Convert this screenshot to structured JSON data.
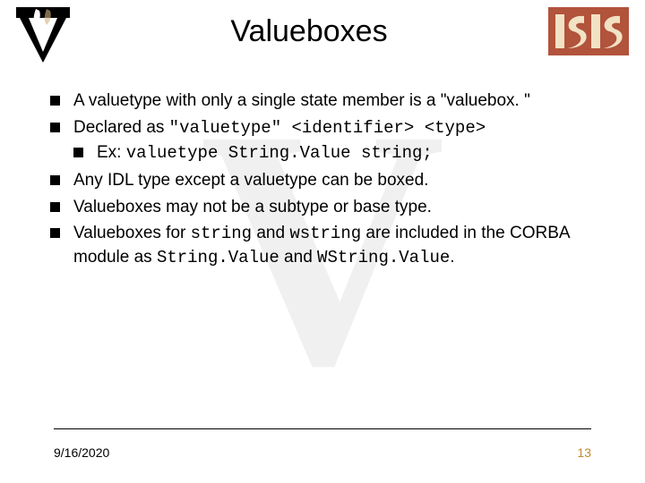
{
  "title": "Valueboxes",
  "bullets": {
    "b1": "A valuetype with only a single state member is a \"valuebox. \"",
    "b2_prefix": "Declared as ",
    "b2_code": "\"valuetype\" <identifier> <type>",
    "b2_sub_prefix": "Ex: ",
    "b2_sub_code": "valuetype String.Value string;",
    "b3": "Any IDL type except a valuetype can be boxed.",
    "b4": "Valueboxes may not be a subtype or base type.",
    "b5_part1": "Valueboxes for ",
    "b5_code1": "string",
    "b5_part2": " and ",
    "b5_code2": "wstring",
    "b5_part3": " are included in the CORBA module as ",
    "b5_code3": "String.Value",
    "b5_part4": " and ",
    "b5_code4": "WString.Value",
    "b5_part5": "."
  },
  "footer": {
    "date": "9/16/2020",
    "page": "13"
  },
  "logos": {
    "left_alt": "vanderbilt-v-logo",
    "right_alt": "isis-logo"
  }
}
